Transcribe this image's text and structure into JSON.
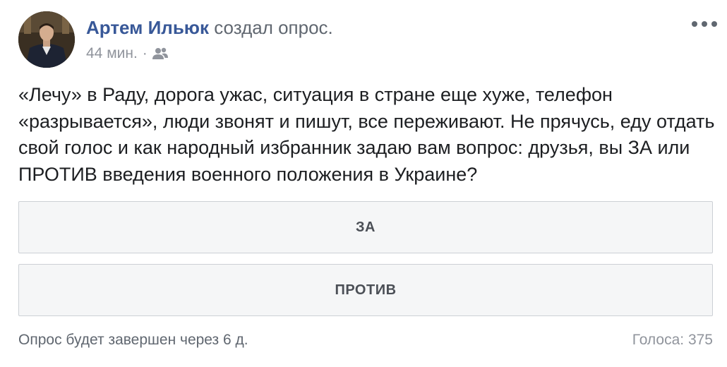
{
  "post": {
    "author_name": "Артем Ильюк",
    "author_action": "создал опрос.",
    "time": "44 мин.",
    "separator": "·",
    "audience_icon": "friends-icon",
    "text": "«Лечу» в Раду, дорога ужас, ситуация в стране еще хуже, телефон «разрывается», люди звонят и пишут, все переживают. Не прячусь, еду отдать свой голос и как народный избранник задаю вам вопрос: друзья, вы ЗА или ПРОТИВ введения военного положения в Украине?"
  },
  "poll": {
    "options": [
      {
        "label": "ЗА"
      },
      {
        "label": "ПРОТИВ"
      }
    ],
    "status": "Опрос будет завершен через 6 д.",
    "votes": "Голоса: 375"
  },
  "colors": {
    "author_link": "#385898",
    "secondary_text": "#90949c",
    "option_bg": "#f5f6f7",
    "option_border": "#ccd0d5"
  }
}
